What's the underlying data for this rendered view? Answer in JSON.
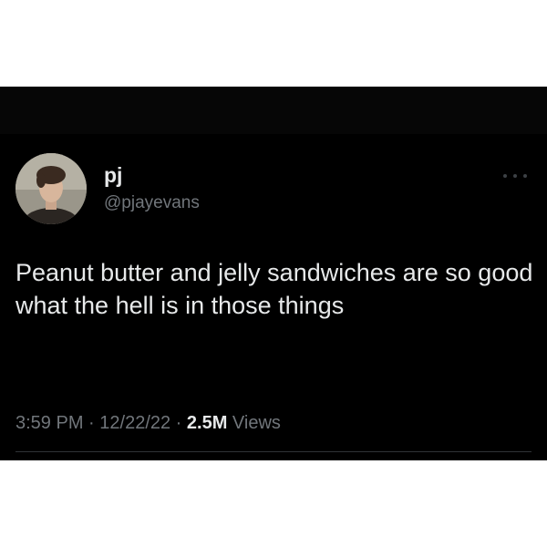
{
  "tweet": {
    "author": {
      "display_name": "pj",
      "handle": "@pjayevans",
      "avatar_icon": "profile-photo"
    },
    "more_icon": "more-options-icon",
    "text": "Peanut butter and jelly sandwiches are so good what the hell is in those things",
    "meta": {
      "time": "3:59 PM",
      "separator_1": " · ",
      "date": "12/22/22",
      "separator_2": " · ",
      "views_count": "2.5M",
      "views_label": " Views"
    }
  },
  "colors": {
    "background": "#000000",
    "primary_text": "#e7e9ea",
    "secondary_text": "#71767b",
    "divider": "#2f3336"
  }
}
